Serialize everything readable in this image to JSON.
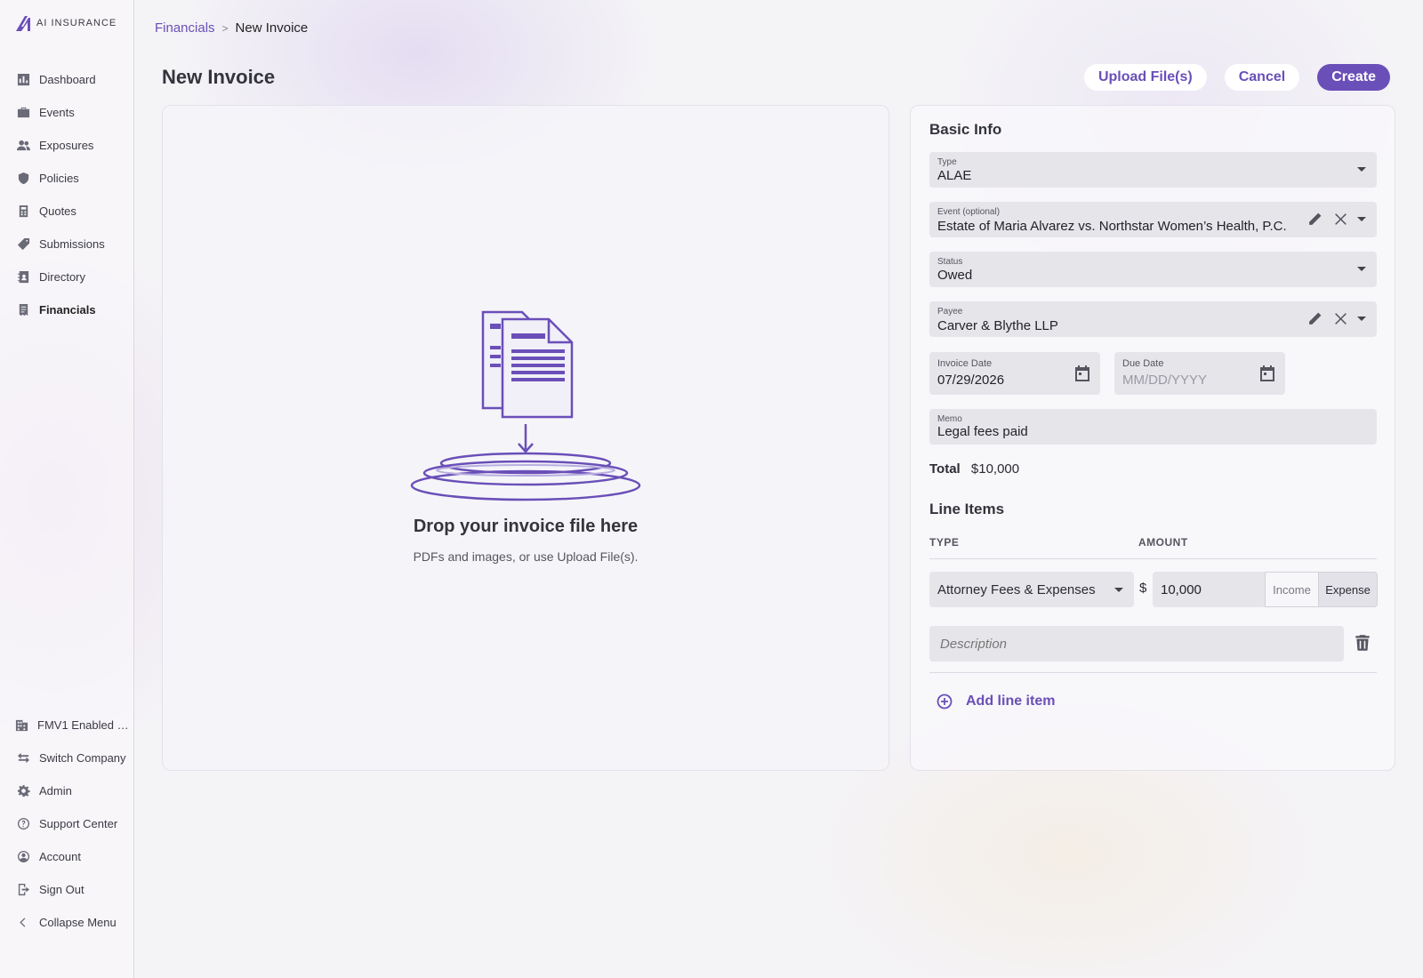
{
  "app": {
    "logo_text": "AI INSURANCE",
    "accent_color": "#6a4fb8"
  },
  "sidebar": {
    "items": [
      {
        "label": "Dashboard",
        "icon": "dashboard-icon"
      },
      {
        "label": "Events",
        "icon": "briefcase-icon"
      },
      {
        "label": "Exposures",
        "icon": "people-icon"
      },
      {
        "label": "Policies",
        "icon": "shield-icon"
      },
      {
        "label": "Quotes",
        "icon": "calculator-icon"
      },
      {
        "label": "Submissions",
        "icon": "tag-icon"
      },
      {
        "label": "Directory",
        "icon": "contacts-icon"
      },
      {
        "label": "Financials",
        "icon": "receipt-icon",
        "active": true
      }
    ],
    "bottom_items": [
      {
        "label": "FMV1 Enabled Company",
        "icon": "company-icon"
      },
      {
        "label": "Switch Company",
        "icon": "swap-icon"
      },
      {
        "label": "Admin",
        "icon": "gear-icon"
      },
      {
        "label": "Support Center",
        "icon": "help-icon"
      },
      {
        "label": "Account",
        "icon": "account-icon"
      },
      {
        "label": "Sign Out",
        "icon": "logout-icon"
      },
      {
        "label": "Collapse Menu",
        "icon": "chevron-left-icon"
      }
    ]
  },
  "breadcrumb": {
    "parent": "Financials",
    "separator": ">",
    "current": "New Invoice"
  },
  "header": {
    "title": "New Invoice",
    "upload_label": "Upload File(s)",
    "cancel_label": "Cancel",
    "create_label": "Create"
  },
  "dropzone": {
    "title": "Drop your invoice file here",
    "subtitle": "PDFs and images, or use Upload File(s)."
  },
  "form": {
    "section_basic": "Basic Info",
    "type": {
      "label": "Type",
      "value": "ALAE"
    },
    "event": {
      "label": "Event (optional)",
      "value": "Estate of Maria Alvarez vs. Northstar Women’s Health, P.C."
    },
    "status": {
      "label": "Status",
      "value": "Owed"
    },
    "payee": {
      "label": "Payee",
      "value": "Carver & Blythe LLP"
    },
    "invoice_date": {
      "label": "Invoice Date",
      "value": "07/29/2026"
    },
    "due_date": {
      "label": "Due Date",
      "placeholder": "MM/DD/YYYY"
    },
    "memo": {
      "label": "Memo",
      "value": "Legal fees paid"
    },
    "total_label": "Total",
    "total_value": "$10,000"
  },
  "line_items": {
    "section_title": "Line Items",
    "col_type": "TYPE",
    "col_amount": "AMOUNT",
    "items": [
      {
        "type": "Attorney Fees & Expenses",
        "currency": "$",
        "amount": "10,000",
        "income_label": "Income",
        "expense_label": "Expense",
        "selected": "Expense",
        "description_placeholder": "Description"
      }
    ],
    "add_label": "Add line item"
  }
}
